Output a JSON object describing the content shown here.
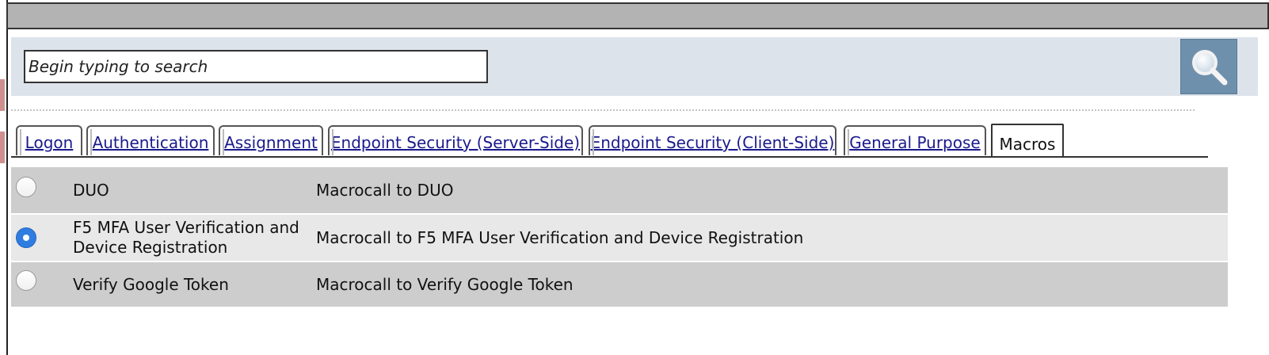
{
  "search": {
    "placeholder": "Begin typing to search",
    "button_icon": "magnifier-icon"
  },
  "tabs": [
    {
      "label": "Logon",
      "active": false
    },
    {
      "label": "Authentication",
      "active": false
    },
    {
      "label": "Assignment",
      "active": false
    },
    {
      "label": "Endpoint Security (Server-Side)",
      "active": false
    },
    {
      "label": "Endpoint Security (Client-Side)",
      "active": false
    },
    {
      "label": "General Purpose",
      "active": false
    },
    {
      "label": "Macros",
      "active": true
    }
  ],
  "rows": [
    {
      "name": "DUO",
      "description": "Macrocall to DUO",
      "selected": false
    },
    {
      "name": "F5 MFA User Verification and Device Registration",
      "description": "Macrocall to F5 MFA User Verification and Device Registration",
      "selected": true
    },
    {
      "name": "Verify Google Token",
      "description": "Macrocall to Verify Google Token",
      "selected": false
    }
  ],
  "colors": {
    "link": "#1a1a8c",
    "row_dark": "#cdcdcd",
    "row_light": "#e8e8e8",
    "search_panel": "#dde3ea",
    "search_button": "#6f90ad",
    "radio_selected": "#2f7de1"
  }
}
